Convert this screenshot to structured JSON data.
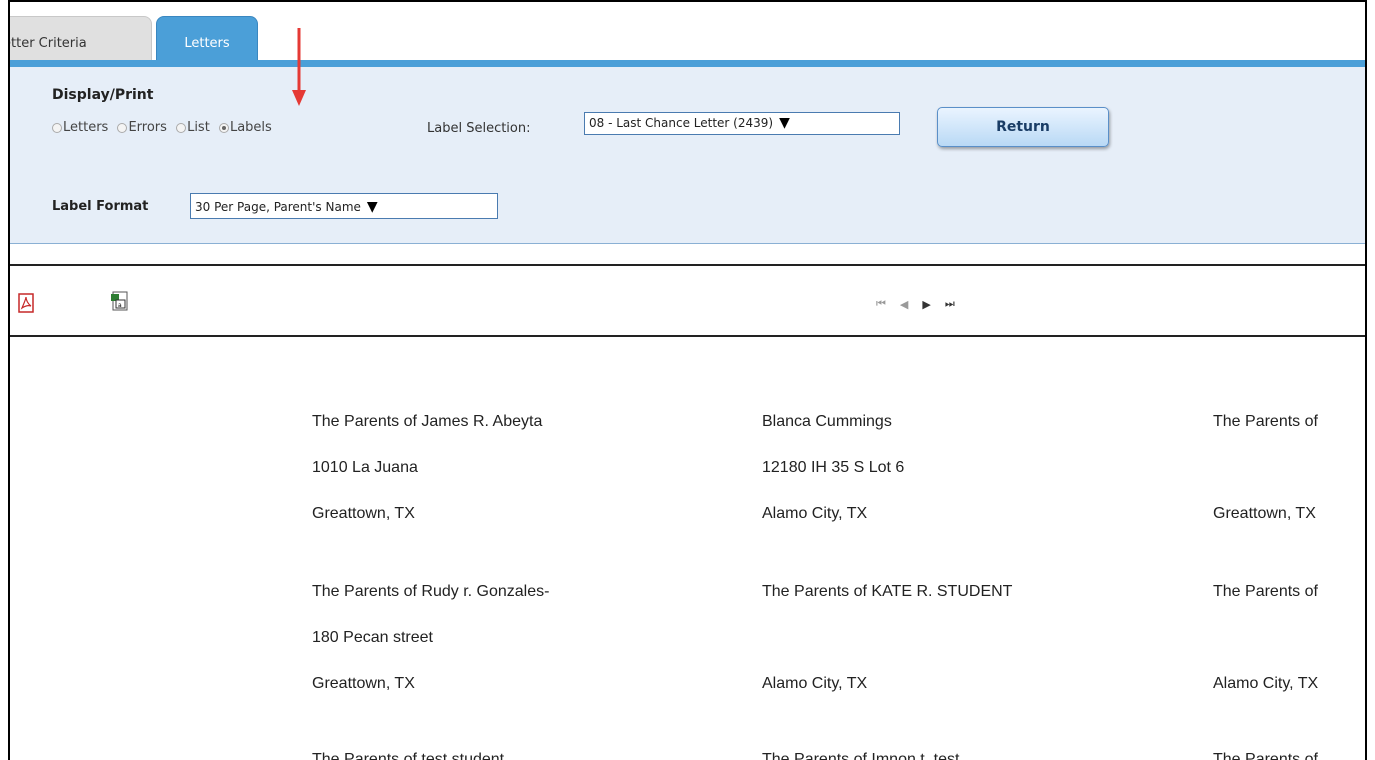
{
  "tabs": [
    {
      "label": "etter Criteria",
      "active": false
    },
    {
      "label": "Letters",
      "active": true
    }
  ],
  "criteria": {
    "display_print_title": "Display/Print",
    "radio_options": [
      "Letters",
      "Errors",
      "List",
      "Labels"
    ],
    "selected_radio": "Labels",
    "label_selection_label": "Label Selection:",
    "label_selection_value": "08 - Last Chance Letter (2439)",
    "return_label": "Return",
    "label_format_label": "Label Format",
    "label_format_value": "30 Per Page, Parent's Name"
  },
  "toolbar": {
    "pdf_icon": "pdf-export-icon",
    "excel_icon": "excel-export-icon",
    "pager_glyphs": [
      "⏮",
      "◀",
      "▶",
      "⏭"
    ]
  },
  "labels": [
    {
      "lines": [
        "The Parents of James R. Abeyta",
        "1010 La Juana",
        "Greattown, TX"
      ]
    },
    {
      "lines": [
        "Blanca Cummings",
        "12180 IH 35 S Lot 6",
        "Alamo City, TX"
      ]
    },
    {
      "lines": [
        "The Parents of",
        "",
        "Greattown, TX"
      ]
    },
    {
      "lines": [
        "The Parents of Rudy r. Gonzales-",
        "180 Pecan street",
        "Greattown, TX"
      ]
    },
    {
      "lines": [
        "The Parents of KATE R. STUDENT",
        "",
        "Alamo City, TX"
      ]
    },
    {
      "lines": [
        "The Parents of",
        "",
        "Alamo City, TX"
      ]
    },
    {
      "lines": [
        "The Parents of test student",
        "",
        ""
      ]
    },
    {
      "lines": [
        "The Parents of Imnon t. test",
        "",
        ""
      ]
    },
    {
      "lines": [
        "The Parents of",
        "",
        ""
      ]
    }
  ],
  "colors": {
    "tab_active": "#4b9fd8",
    "panel_bg": "#e6eef8",
    "annotation_arrow": "#e53935"
  }
}
